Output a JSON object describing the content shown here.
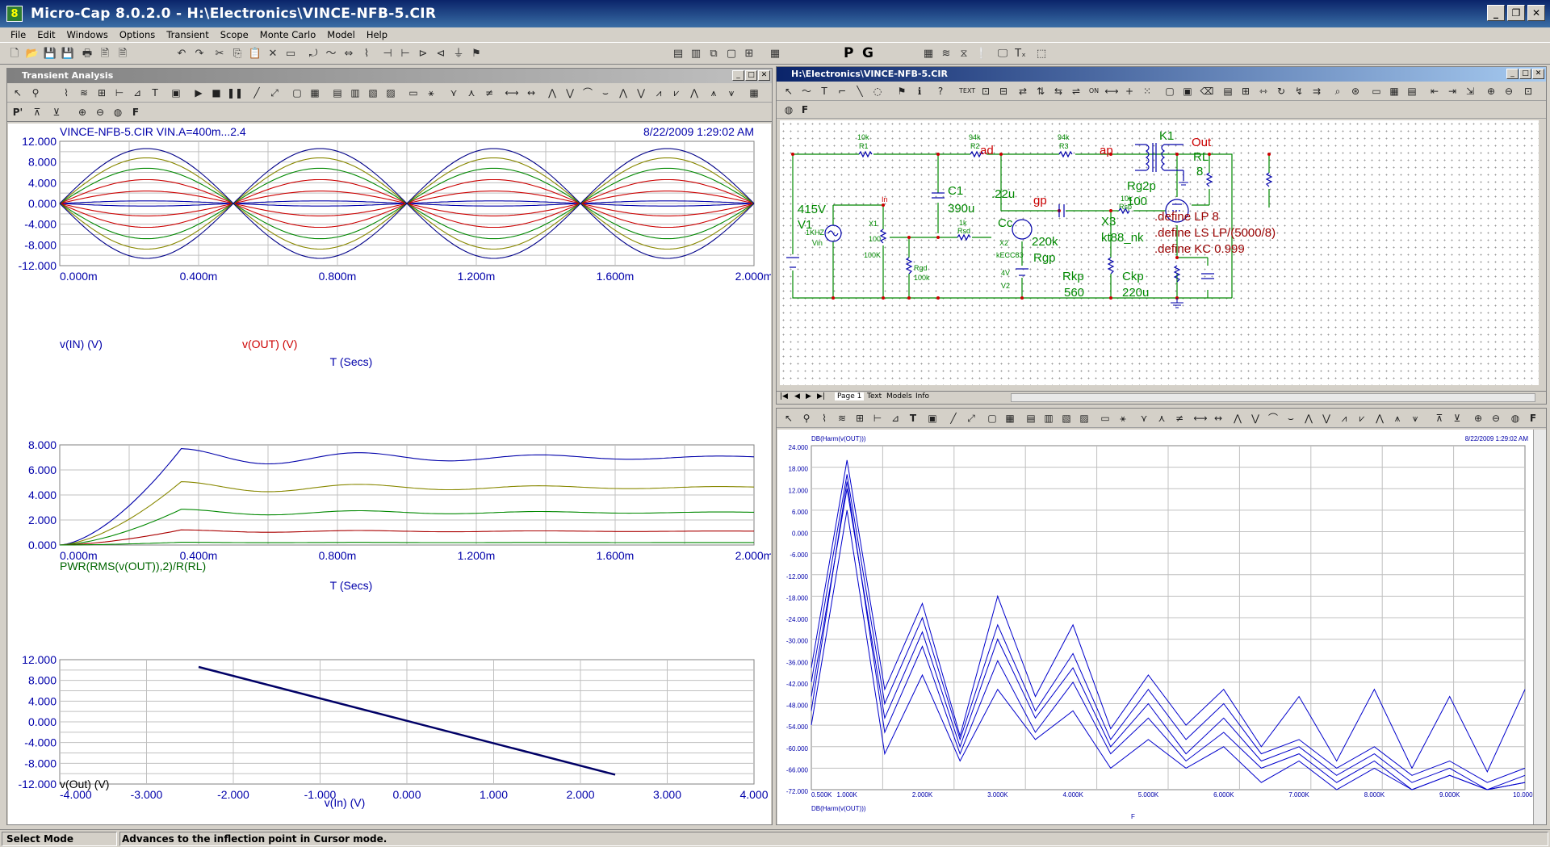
{
  "window": {
    "title": "Micro-Cap 8.0.2.0 - H:\\Electronics\\VINCE-NFB-5.CIR",
    "icon_glyph": "8"
  },
  "menu": [
    "File",
    "Edit",
    "Windows",
    "Options",
    "Transient",
    "Scope",
    "Monte Carlo",
    "Model",
    "Help"
  ],
  "toolbar": {
    "probe_p": "P",
    "probe_g": "G"
  },
  "transient_panel": {
    "title": "Transient Analysis",
    "header_left": "VINCE-NFB-5.CIR VIN.A=400m...2.4",
    "header_right": "8/22/2009 1:29:02 AM",
    "plot1": {
      "y_ticks": [
        "12.000",
        "8.000",
        "4.000",
        "0.000",
        "-4.000",
        "-8.000",
        "-12.000"
      ],
      "x_ticks": [
        "0.000m",
        "0.400m",
        "0.800m",
        "1.200m",
        "1.600m",
        "2.000m"
      ],
      "label1": "v(IN) (V)",
      "label2": "v(OUT) (V)",
      "xlabel": "T (Secs)"
    },
    "plot2": {
      "y_ticks": [
        "8.000",
        "6.000",
        "4.000",
        "2.000",
        "0.000"
      ],
      "x_ticks": [
        "0.000m",
        "0.400m",
        "0.800m",
        "1.200m",
        "1.600m",
        "2.000m"
      ],
      "label1": "PWR(RMS(v(OUT)),2)/R(RL)",
      "xlabel": "T (Secs)"
    },
    "plot3": {
      "y_ticks": [
        "12.000",
        "8.000",
        "4.000",
        "0.000",
        "-4.000",
        "-8.000",
        "-12.000"
      ],
      "x_ticks": [
        "-4.000",
        "-3.000",
        "-2.000",
        "-1.000",
        "0.000",
        "1.000",
        "2.000",
        "3.000",
        "4.000"
      ],
      "label1": "v(Out) (V)",
      "xlabel": "v(In) (V)"
    }
  },
  "schematic_panel": {
    "title": "H:\\Electronics\\VINCE-NFB-5.CIR",
    "tabs": [
      "Page 1",
      "Text",
      "Models",
      "Info"
    ],
    "labels": {
      "K1": "K1",
      "Out": "Out",
      "RL": "RL",
      "RL_val": "8",
      "R1": "R1",
      "R1_val": "10k",
      "R2": "R2",
      "R2_val": "94k",
      "R3": "R3",
      "R3_val": "94k",
      "ad": "ad",
      "ap": "ap",
      "gp": "gp",
      "C1": "C1",
      "C1_val": "390u",
      "Cc_val": ".22u",
      "Cc": "Cc",
      "V1_val": "415V",
      "V1": "V1",
      "in": "In",
      "X1": "X1",
      "X1_val": "100",
      "X1_val2": "100K",
      "Vin_val": "1KHZ",
      "Vin": "Vin",
      "Rsd_val": "1k",
      "Rsd": "Rsd",
      "X2": "X2",
      "X2_model": "kECC83",
      "V2_val": "4V",
      "V2": "V2",
      "Rgd": "Rgd",
      "Rgd_val": "100k",
      "Rsp_val": "10k",
      "Rsp": "Rsp",
      "Rgp_val": "220k",
      "Rgp": "Rgp",
      "X3": "X3",
      "X3_model": "kt88_nk",
      "Rg2p": "Rg2p",
      "Rg2p_val": "100",
      "Rkp": "Rkp",
      "Rkp_val": "560",
      "Ckp": "Ckp",
      "Ckp_val": "220u",
      "def1": ".define LP 8",
      "def2": ".define LS LP/(5000/8)",
      "def3": ".define KC 0.999"
    }
  },
  "fft_panel": {
    "header_left": "DB(Harm(v(OUT)))",
    "header_right": "8/22/2009 1:29:02 AM",
    "y_ticks": [
      "24.000",
      "18.000",
      "12.000",
      "6.000",
      "0.000",
      "-6.000",
      "-12.000",
      "-18.000",
      "-24.000",
      "-30.000",
      "-36.000",
      "-42.000",
      "-48.000",
      "-54.000",
      "-60.000",
      "-66.000",
      "-72.000"
    ],
    "x_ticks": [
      "0.500K",
      "1.000K",
      "2.000K",
      "3.000K",
      "4.000K",
      "5.000K",
      "6.000K",
      "7.000K",
      "8.000K",
      "9.000K",
      "10.000K"
    ],
    "ylabel_bottom": "DB(Harm(v(OUT)))",
    "xlabel": "F"
  },
  "status": {
    "mode": "Select Mode",
    "hint": "Advances to the inflection point in Cursor mode."
  }
}
